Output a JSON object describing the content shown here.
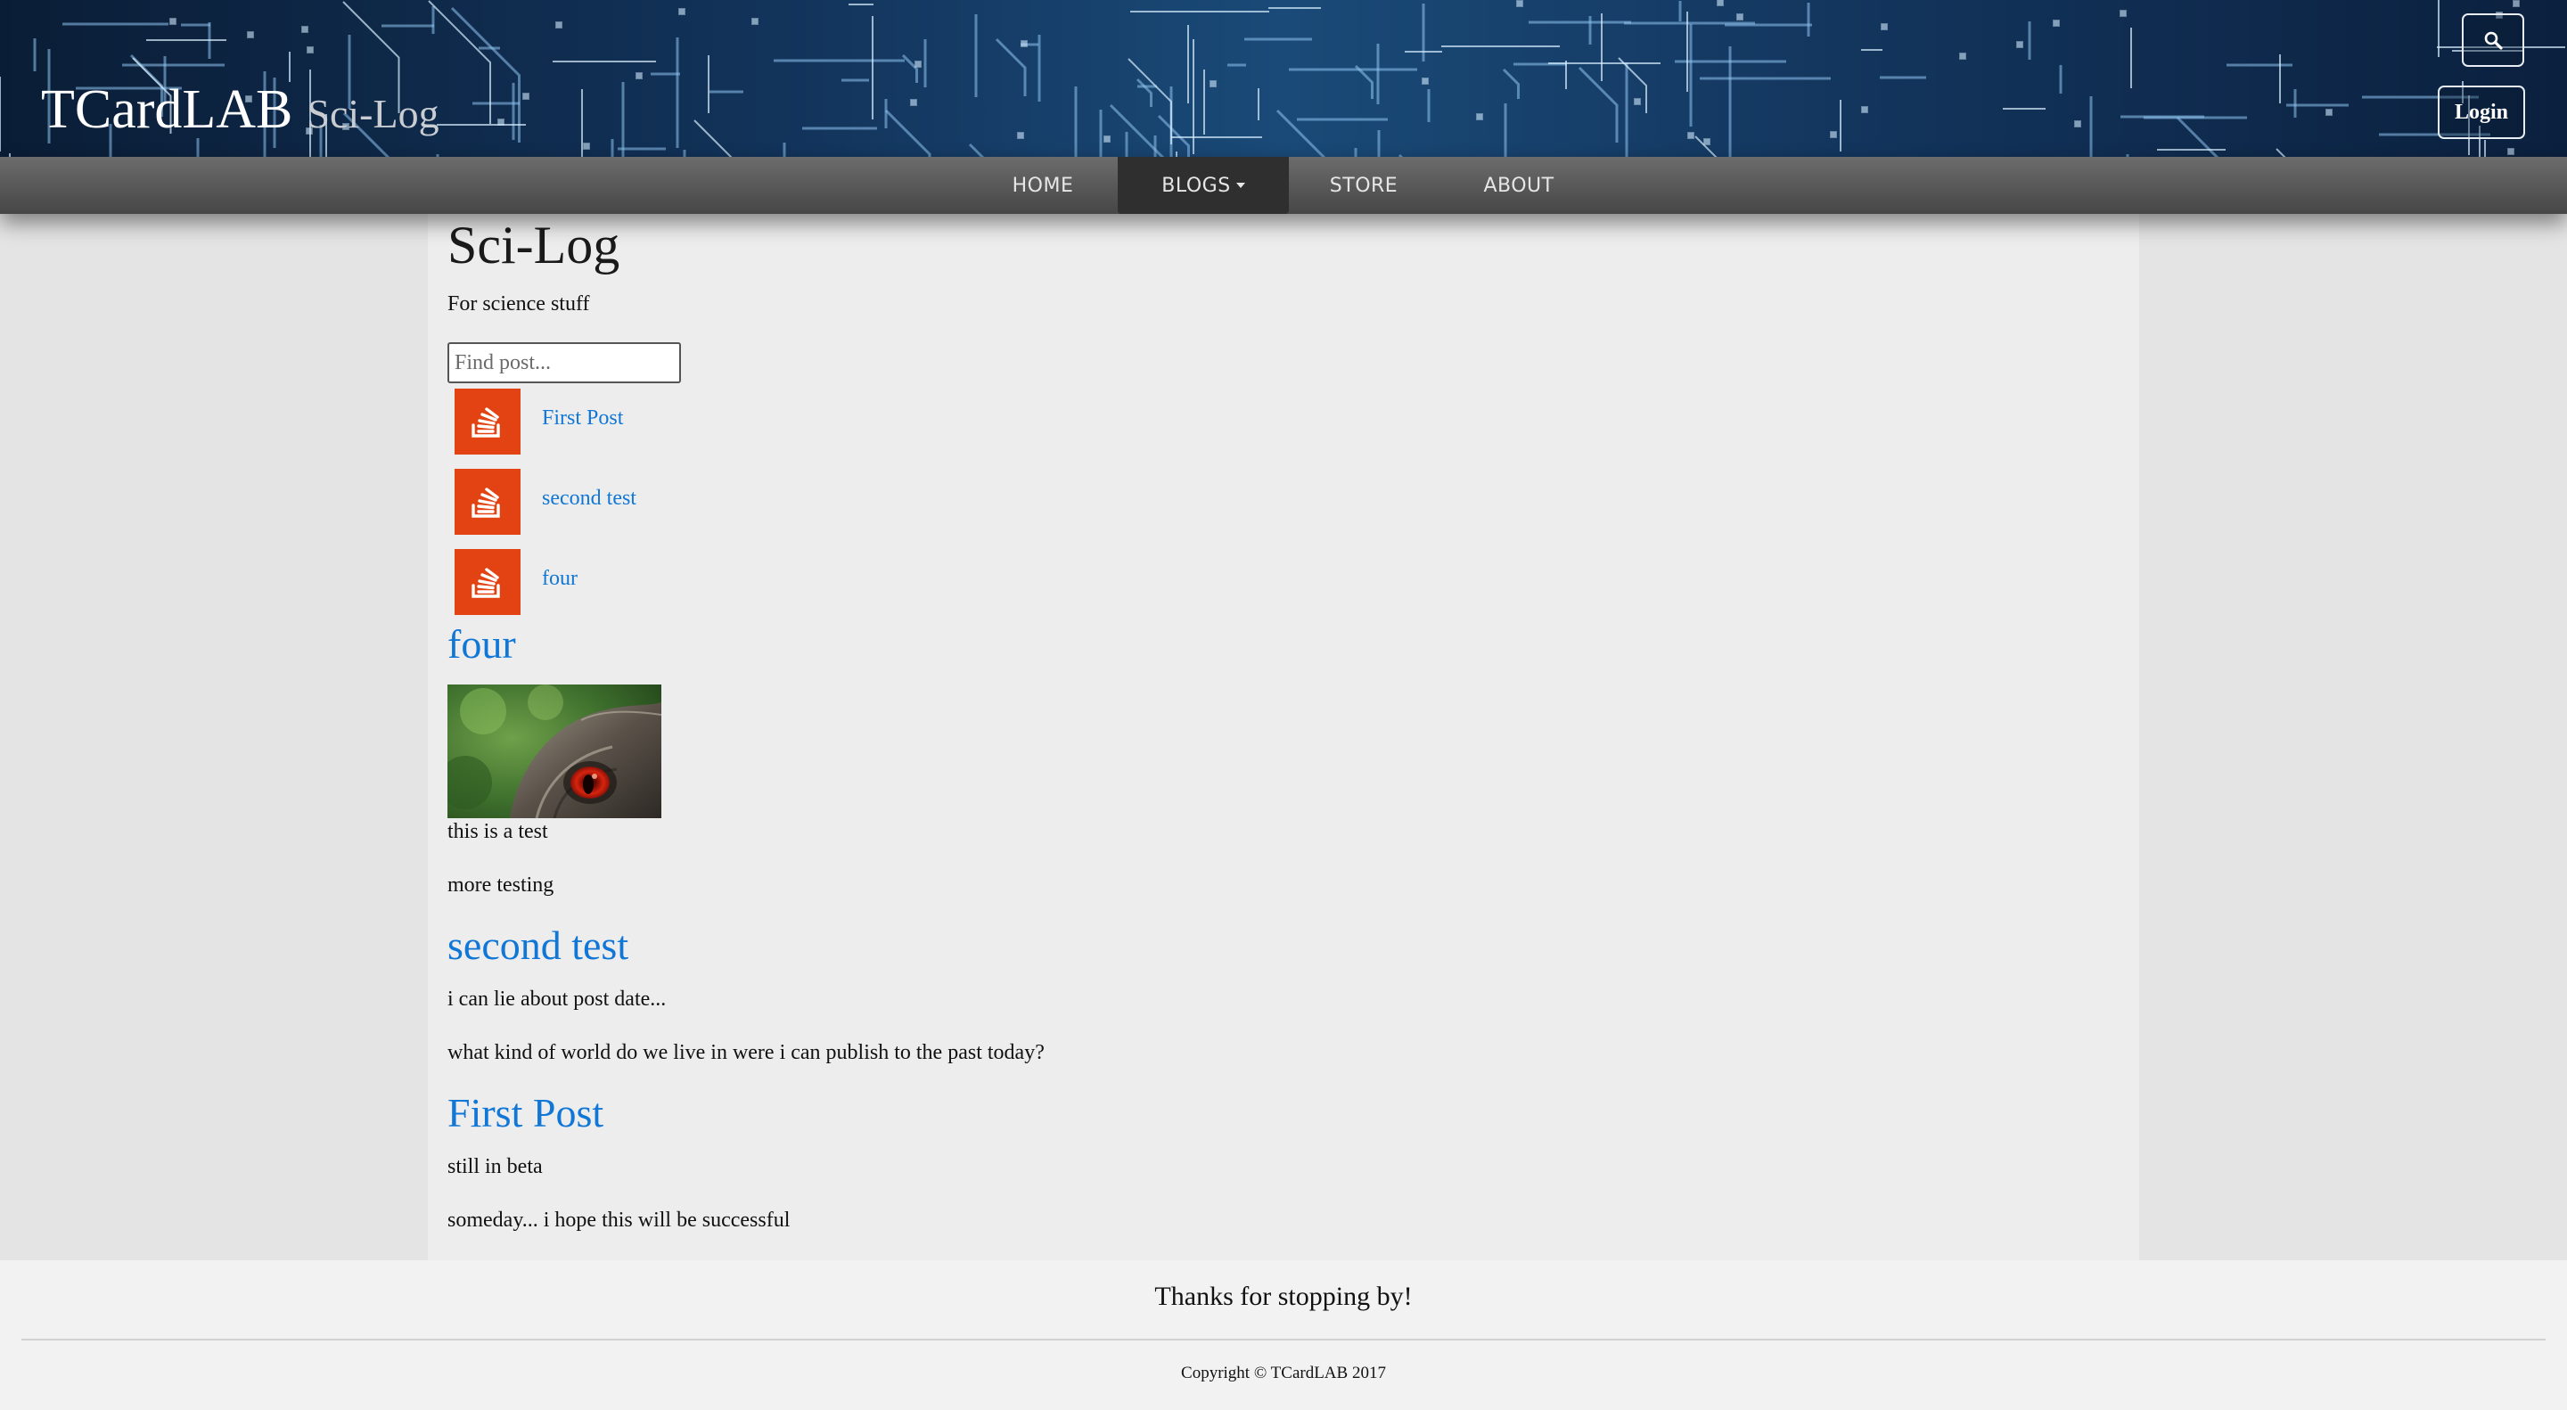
{
  "header": {
    "brand": "TCardLAB",
    "brand_sub": "Sci-Log",
    "search_icon": "search-icon",
    "login_label": "Login"
  },
  "nav": {
    "items": [
      {
        "label": "HOME"
      },
      {
        "label": "BLOGS",
        "active": true,
        "dropdown": true
      },
      {
        "label": "STORE"
      },
      {
        "label": "ABOUT"
      }
    ]
  },
  "blog": {
    "title": "Sci-Log",
    "subtitle": "For science stuff",
    "search_placeholder": "Find post...",
    "post_list": [
      {
        "title": "First Post",
        "icon": "stack-icon"
      },
      {
        "title": "second test",
        "icon": "stack-icon"
      },
      {
        "title": "four",
        "icon": "stack-icon"
      }
    ],
    "posts": [
      {
        "title": "four",
        "paragraphs": [
          "this is a test",
          "more testing"
        ],
        "has_image": true
      },
      {
        "title": "second test",
        "paragraphs": [
          "i can lie about post date...",
          "what kind of world do we live in were i can publish to the past today?"
        ]
      },
      {
        "title": "First Post",
        "paragraphs": [
          "still in beta",
          "someday... i hope this will be successful"
        ]
      }
    ]
  },
  "footer": {
    "thanks": "Thanks for stopping by!",
    "copyright": "Copyright © TCardLAB 2017"
  },
  "colors": {
    "link": "#1177d6",
    "post_icon_bg": "#e34213",
    "navbar": "#575757",
    "nav_active": "#2f2f2f"
  }
}
